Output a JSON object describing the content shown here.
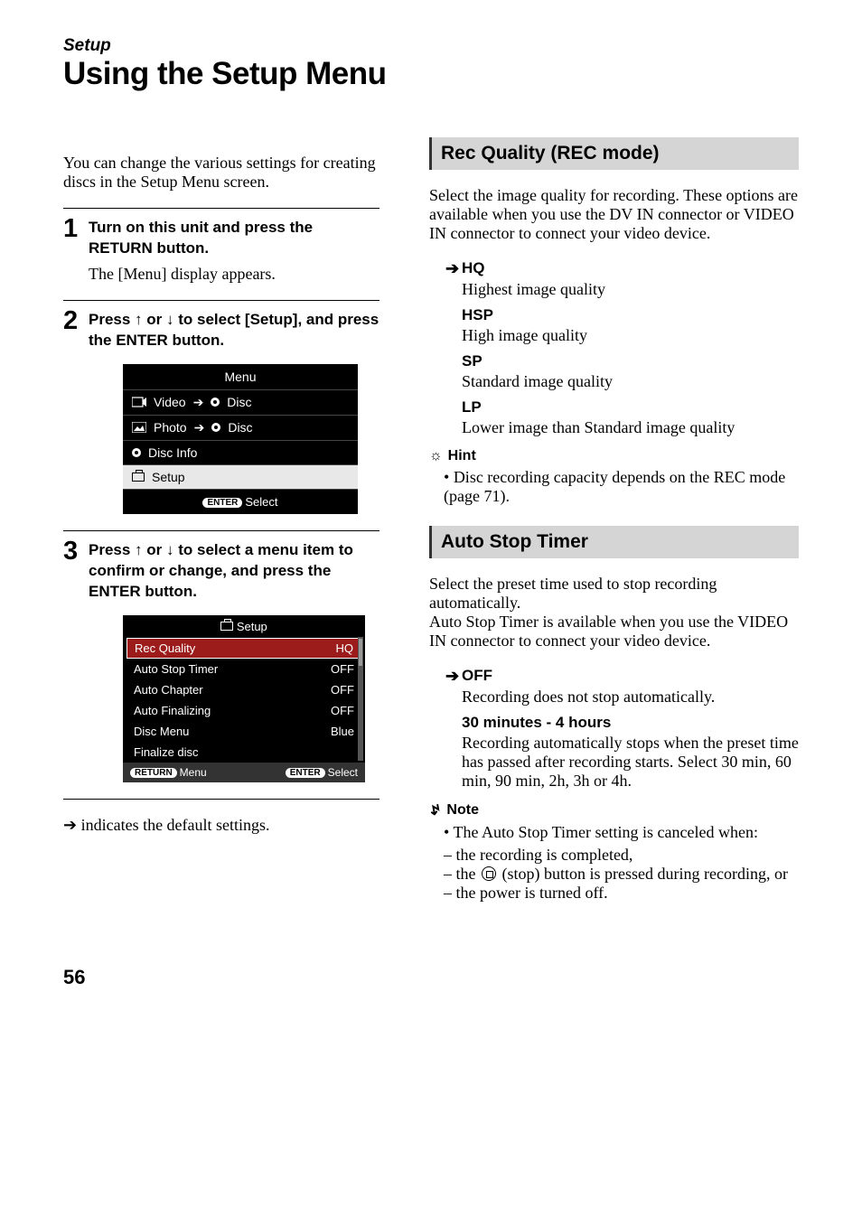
{
  "header": {
    "section": "Setup",
    "title": "Using the Setup Menu"
  },
  "intro": "You can change the various settings for creating discs in the Setup Menu screen.",
  "steps": [
    {
      "num": "1",
      "heading": "Turn on this unit and press the RETURN button.",
      "body": "The [Menu] display appears."
    },
    {
      "num": "2",
      "heading": "Press ↑ or ↓ to select [Setup], and press the ENTER button.",
      "menu": {
        "title": "Menu",
        "items": [
          {
            "label_left": "Video",
            "label_right": "Disc",
            "icons": [
              "video",
              "arrow",
              "disc"
            ]
          },
          {
            "label_left": "Photo",
            "label_right": "Disc",
            "icons": [
              "photo",
              "arrow",
              "disc"
            ]
          },
          {
            "label_left": "Disc Info",
            "label_right": "",
            "icons": [
              "discinfo"
            ]
          },
          {
            "label_left": "Setup",
            "label_right": "",
            "icons": [
              "setup"
            ],
            "selected": true
          }
        ],
        "footer_button": "ENTER",
        "footer_label": "Select"
      }
    },
    {
      "num": "3",
      "heading": "Press ↑ or ↓ to select a menu item to confirm or change, and press the ENTER button.",
      "setup": {
        "title": "Setup",
        "rows": [
          {
            "label": "Rec Quality",
            "value": "HQ",
            "selected": true
          },
          {
            "label": "Auto Stop Timer",
            "value": "OFF"
          },
          {
            "label": "Auto Chapter",
            "value": "OFF"
          },
          {
            "label": "Auto Finalizing",
            "value": "OFF"
          },
          {
            "label": "Disc Menu",
            "value": "Blue"
          },
          {
            "label": "Finalize disc",
            "value": ""
          }
        ],
        "footer_left_button": "RETURN",
        "footer_left_label": "Menu",
        "footer_right_button": "ENTER",
        "footer_right_label": "Select"
      }
    }
  ],
  "default_note_arrow": "➔",
  "default_note": "indicates the default settings.",
  "sections": [
    {
      "heading": "Rec Quality (REC mode)",
      "intro": "Select the image quality for recording. These options are available when you use the DV IN connector or VIDEO IN connector to connect your video device.",
      "defs": [
        {
          "term": "HQ",
          "desc": "Highest image quality",
          "default": true
        },
        {
          "term": "HSP",
          "desc": "High image quality"
        },
        {
          "term": "SP",
          "desc": "Standard image quality"
        },
        {
          "term": "LP",
          "desc": "Lower image than Standard image quality"
        }
      ],
      "hint_label": "Hint",
      "hints": [
        "Disc recording capacity depends on the REC mode (page 71)."
      ]
    },
    {
      "heading": "Auto Stop Timer",
      "intro": "Select the preset time used to stop recording automatically.\nAuto Stop Timer is available when you use the VIDEO IN connector to connect your video device.",
      "defs": [
        {
          "term": "OFF",
          "desc": "Recording does not stop automatically.",
          "default": true
        },
        {
          "term": "30 minutes - 4 hours",
          "desc": "Recording automatically stops when the preset time has passed after recording starts. Select 30 min, 60 min, 90 min, 2h, 3h or 4h."
        }
      ],
      "note_label": "Note",
      "notes_intro": "The Auto Stop Timer setting is canceled when:",
      "notes": [
        "the recording is completed,",
        "the ■ (stop) button is pressed during recording, or",
        "the power is turned off."
      ]
    }
  ],
  "page_number": "56"
}
